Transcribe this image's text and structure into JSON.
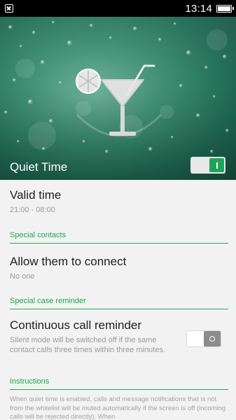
{
  "status_bar": {
    "time": "13:14",
    "notification_icon": "close-box-icon",
    "battery_icon": "battery-full-icon",
    "battery_level": 1.0
  },
  "hero": {
    "title": "Quiet Time",
    "illustration_icon": "cocktail-glass-icon",
    "toggle_state": "on",
    "accent_color": "#1ea45a"
  },
  "settings": {
    "valid_time": {
      "title": "Valid time",
      "value": "21:00 - 08:00"
    },
    "special_contacts": {
      "section_label": "Special contacts",
      "title": "Allow them to connect",
      "value": "No one"
    },
    "special_case": {
      "section_label": "Special case reminder",
      "title": "Continuous call reminder",
      "description": "Silent mode will be switched off if the same contact calls three times within three minutes.",
      "toggle_state": "off"
    },
    "instructions": {
      "section_label": "Instructions",
      "text": "When quiet time is enabled, calls and message notifications that is not from the whitelist will be muted automatically if the screen is off (incoming calls will be rejected directly). When"
    }
  }
}
